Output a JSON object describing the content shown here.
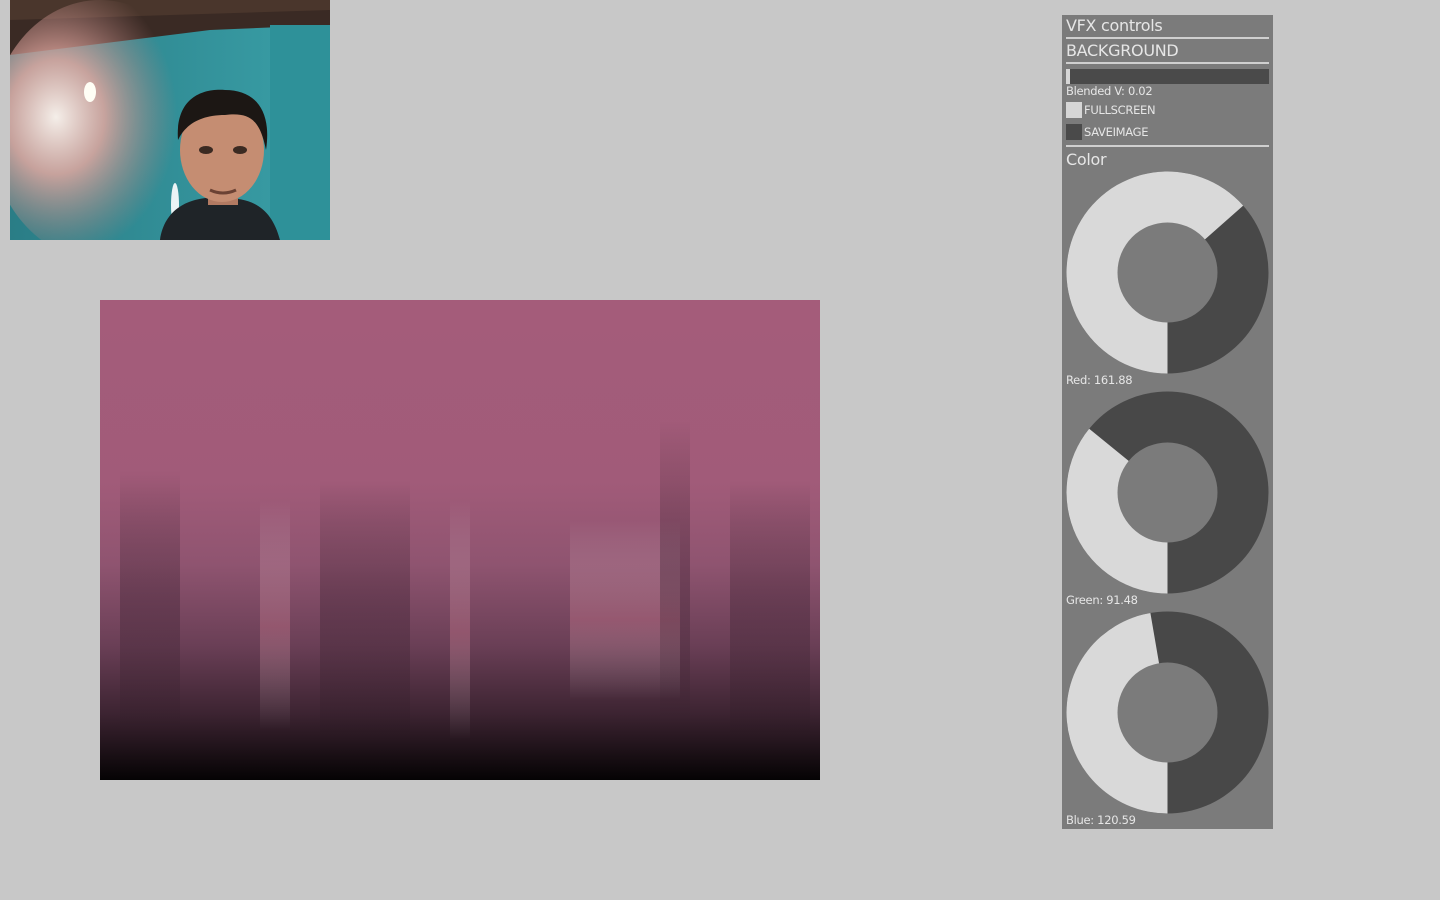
{
  "webcam": {
    "description_icon": "camera-feed-icon"
  },
  "output": {
    "icon": "processed-video-icon"
  },
  "panel": {
    "title": "VFX controls",
    "group_background": "BACKGROUND",
    "blended": {
      "label": "Blended V: 0.02",
      "value": 0.02
    },
    "fullscreen": {
      "label": "FULLSCREEN",
      "checked": true
    },
    "saveimage": {
      "label": "SAVEIMAGE",
      "checked": false
    },
    "group_color": "Color",
    "knobs": [
      {
        "label": "Red: 161.88",
        "value": 161.88,
        "max": 255
      },
      {
        "label": "Green: 91.48",
        "value": 91.48,
        "max": 255
      },
      {
        "label": "Blue: 120.59",
        "value": 120.59,
        "max": 255
      }
    ]
  },
  "colors": {
    "panel_bg": "#7b7b7b",
    "knob_fill": "#d9d9d9",
    "knob_track": "#484848",
    "output_tint": "#a45c7c"
  }
}
